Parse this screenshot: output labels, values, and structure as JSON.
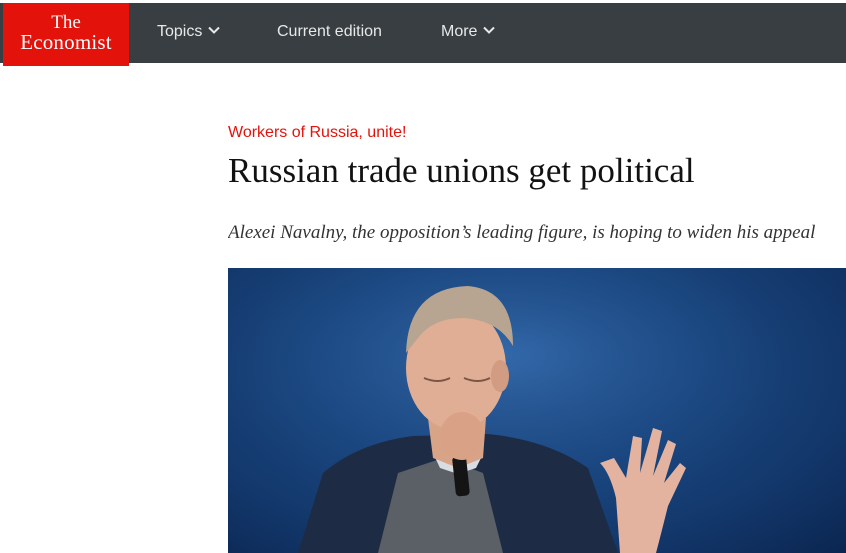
{
  "header": {
    "logo_line1": "The",
    "logo_line2": "Economist",
    "nav": [
      {
        "label": "Topics",
        "has_dropdown": true
      },
      {
        "label": "Current edition",
        "has_dropdown": false
      },
      {
        "label": "More",
        "has_dropdown": true
      }
    ]
  },
  "article": {
    "flytitle": "Workers of Russia, unite!",
    "headline": "Russian trade unions get political",
    "rubric": "Alexei Navalny, the opposition’s leading figure, is hoping to widen his appeal"
  },
  "colors": {
    "brand_red": "#e3120b",
    "nav_bg": "#383e42",
    "text": "#121212"
  }
}
